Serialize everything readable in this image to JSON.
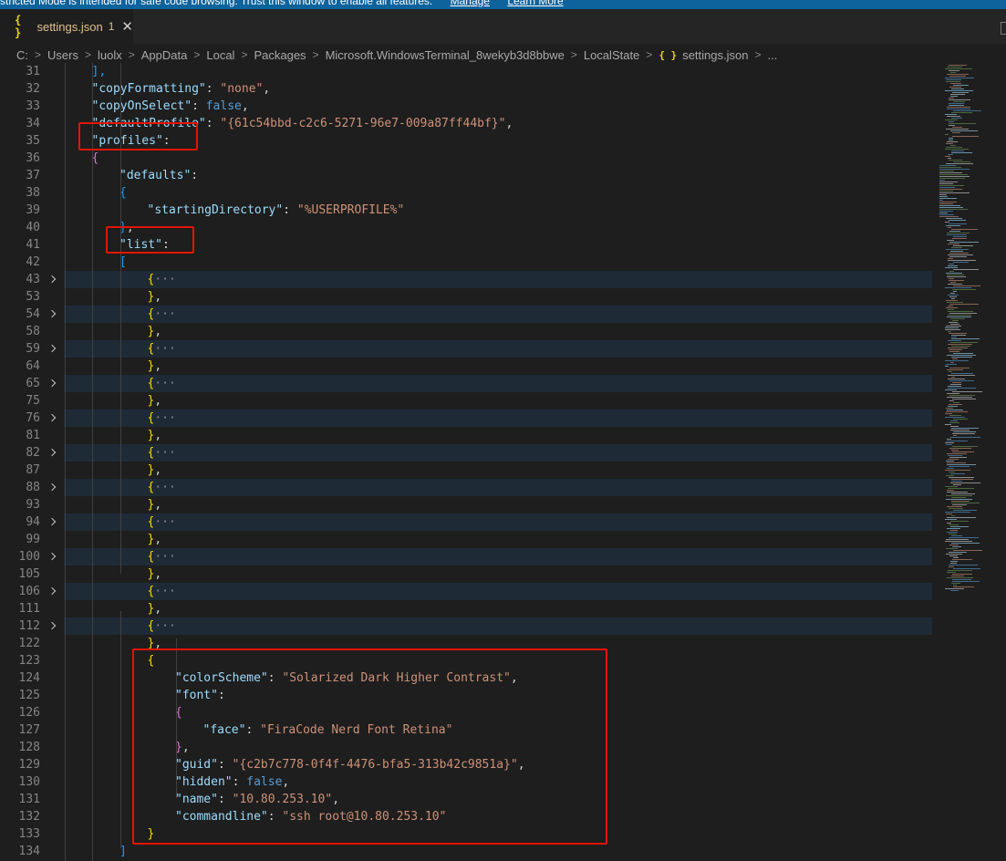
{
  "banner": {
    "text": "stricted Mode is intended for safe code browsing. Trust this window to enable all features.",
    "manage": "Manage",
    "learn_more": "Learn More"
  },
  "tab": {
    "icon_text": "{ }",
    "title": "settings.json",
    "badge": "1",
    "close": "✕"
  },
  "breadcrumb": {
    "segments": [
      "C:",
      "Users",
      "luolx",
      "AppData",
      "Local",
      "Packages",
      "Microsoft.WindowsTerminal_8wekyb3d8bbwe",
      "LocalState"
    ],
    "file_icon": "{ }",
    "file": "settings.json",
    "ellipsis": "..."
  },
  "colors": {
    "string": "#ce9178",
    "key": "#9cdcfe",
    "keyword": "#569cd6",
    "highlight_box": "#e51400",
    "folded_line_bg": "#1f2a37"
  },
  "icons": {
    "fold_chevron": "chevron-right-icon",
    "json_file": "json-braces-icon",
    "close": "close-icon"
  },
  "editor": {
    "lines": [
      {
        "n": "31",
        "i": 1,
        "fold": false,
        "t": [
          {
            "c": "b3",
            "v": "],"
          }
        ]
      },
      {
        "n": "32",
        "i": 1,
        "fold": false,
        "t": [
          {
            "c": "k",
            "v": "\"copyFormatting\""
          },
          {
            "c": "p",
            "v": ": "
          },
          {
            "c": "s",
            "v": "\"none\""
          },
          {
            "c": "p",
            "v": ","
          }
        ]
      },
      {
        "n": "33",
        "i": 1,
        "fold": false,
        "t": [
          {
            "c": "k",
            "v": "\"copyOnSelect\""
          },
          {
            "c": "p",
            "v": ": "
          },
          {
            "c": "kw",
            "v": "false"
          },
          {
            "c": "p",
            "v": ","
          }
        ]
      },
      {
        "n": "34",
        "i": 1,
        "fold": false,
        "t": [
          {
            "c": "k",
            "v": "\"defaultProfile\""
          },
          {
            "c": "p",
            "v": ": "
          },
          {
            "c": "s",
            "v": "\"{61c54bbd-c2c6-5271-96e7-009a87ff44bf}\""
          },
          {
            "c": "p",
            "v": ","
          }
        ]
      },
      {
        "n": "35",
        "i": 1,
        "fold": false,
        "t": [
          {
            "c": "k",
            "v": "\"profiles\""
          },
          {
            "c": "p",
            "v": ":"
          }
        ]
      },
      {
        "n": "36",
        "i": 1,
        "fold": false,
        "t": [
          {
            "c": "b2",
            "v": "{"
          }
        ]
      },
      {
        "n": "37",
        "i": 2,
        "fold": false,
        "t": [
          {
            "c": "k",
            "v": "\"defaults\""
          },
          {
            "c": "p",
            "v": ":"
          }
        ]
      },
      {
        "n": "38",
        "i": 2,
        "fold": false,
        "t": [
          {
            "c": "b3",
            "v": "{"
          }
        ]
      },
      {
        "n": "39",
        "i": 3,
        "fold": false,
        "t": [
          {
            "c": "k",
            "v": "\"startingDirectory\""
          },
          {
            "c": "p",
            "v": ": "
          },
          {
            "c": "s",
            "v": "\"%USERPROFILE%\""
          }
        ]
      },
      {
        "n": "40",
        "i": 2,
        "fold": false,
        "t": [
          {
            "c": "b3",
            "v": "}"
          },
          {
            "c": "p",
            "v": ","
          }
        ]
      },
      {
        "n": "41",
        "i": 2,
        "fold": false,
        "t": [
          {
            "c": "k",
            "v": "\"list\""
          },
          {
            "c": "p",
            "v": ":"
          }
        ]
      },
      {
        "n": "42",
        "i": 2,
        "fold": false,
        "t": [
          {
            "c": "b3",
            "v": "["
          }
        ]
      },
      {
        "n": "43",
        "i": 3,
        "fold": true,
        "t": [
          {
            "c": "b1",
            "v": "{"
          },
          {
            "c": "dots",
            "v": "···"
          }
        ]
      },
      {
        "n": "53",
        "i": 3,
        "fold": false,
        "t": [
          {
            "c": "b1",
            "v": "}"
          },
          {
            "c": "p",
            "v": ","
          }
        ]
      },
      {
        "n": "54",
        "i": 3,
        "fold": true,
        "t": [
          {
            "c": "b1",
            "v": "{"
          },
          {
            "c": "dots",
            "v": "···"
          }
        ]
      },
      {
        "n": "58",
        "i": 3,
        "fold": false,
        "t": [
          {
            "c": "b1",
            "v": "}"
          },
          {
            "c": "p",
            "v": ","
          }
        ]
      },
      {
        "n": "59",
        "i": 3,
        "fold": true,
        "t": [
          {
            "c": "b1",
            "v": "{"
          },
          {
            "c": "dots",
            "v": "···"
          }
        ]
      },
      {
        "n": "64",
        "i": 3,
        "fold": false,
        "t": [
          {
            "c": "b1",
            "v": "}"
          },
          {
            "c": "p",
            "v": ","
          }
        ]
      },
      {
        "n": "65",
        "i": 3,
        "fold": true,
        "t": [
          {
            "c": "b1",
            "v": "{"
          },
          {
            "c": "dots",
            "v": "···"
          }
        ]
      },
      {
        "n": "75",
        "i": 3,
        "fold": false,
        "t": [
          {
            "c": "b1",
            "v": "}"
          },
          {
            "c": "p",
            "v": ","
          }
        ]
      },
      {
        "n": "76",
        "i": 3,
        "fold": true,
        "t": [
          {
            "c": "b1",
            "v": "{"
          },
          {
            "c": "dots",
            "v": "···"
          }
        ]
      },
      {
        "n": "81",
        "i": 3,
        "fold": false,
        "t": [
          {
            "c": "b1",
            "v": "}"
          },
          {
            "c": "p",
            "v": ","
          }
        ]
      },
      {
        "n": "82",
        "i": 3,
        "fold": true,
        "t": [
          {
            "c": "b1",
            "v": "{"
          },
          {
            "c": "dots",
            "v": "···"
          }
        ]
      },
      {
        "n": "87",
        "i": 3,
        "fold": false,
        "t": [
          {
            "c": "b1",
            "v": "}"
          },
          {
            "c": "p",
            "v": ","
          }
        ]
      },
      {
        "n": "88",
        "i": 3,
        "fold": true,
        "t": [
          {
            "c": "b1",
            "v": "{"
          },
          {
            "c": "dots",
            "v": "···"
          }
        ]
      },
      {
        "n": "93",
        "i": 3,
        "fold": false,
        "t": [
          {
            "c": "b1",
            "v": "}"
          },
          {
            "c": "p",
            "v": ","
          }
        ]
      },
      {
        "n": "94",
        "i": 3,
        "fold": true,
        "t": [
          {
            "c": "b1",
            "v": "{"
          },
          {
            "c": "dots",
            "v": "···"
          }
        ]
      },
      {
        "n": "99",
        "i": 3,
        "fold": false,
        "t": [
          {
            "c": "b1",
            "v": "}"
          },
          {
            "c": "p",
            "v": ","
          }
        ]
      },
      {
        "n": "100",
        "i": 3,
        "fold": true,
        "t": [
          {
            "c": "b1",
            "v": "{"
          },
          {
            "c": "dots",
            "v": "···"
          }
        ]
      },
      {
        "n": "105",
        "i": 3,
        "fold": false,
        "t": [
          {
            "c": "b1",
            "v": "}"
          },
          {
            "c": "p",
            "v": ","
          }
        ]
      },
      {
        "n": "106",
        "i": 3,
        "fold": true,
        "t": [
          {
            "c": "b1",
            "v": "{"
          },
          {
            "c": "dots",
            "v": "···"
          }
        ]
      },
      {
        "n": "111",
        "i": 3,
        "fold": false,
        "t": [
          {
            "c": "b1",
            "v": "}"
          },
          {
            "c": "p",
            "v": ","
          }
        ]
      },
      {
        "n": "112",
        "i": 3,
        "fold": true,
        "t": [
          {
            "c": "b1",
            "v": "{"
          },
          {
            "c": "dots",
            "v": "···"
          }
        ]
      },
      {
        "n": "122",
        "i": 3,
        "fold": false,
        "t": [
          {
            "c": "b1",
            "v": "}"
          },
          {
            "c": "p",
            "v": ","
          }
        ]
      },
      {
        "n": "123",
        "i": 3,
        "fold": false,
        "t": [
          {
            "c": "b1",
            "v": "{"
          }
        ]
      },
      {
        "n": "124",
        "i": 4,
        "fold": false,
        "t": [
          {
            "c": "k",
            "v": "\"colorScheme\""
          },
          {
            "c": "p",
            "v": ": "
          },
          {
            "c": "s",
            "v": "\"Solarized Dark Higher Contrast\""
          },
          {
            "c": "p",
            "v": ","
          }
        ]
      },
      {
        "n": "125",
        "i": 4,
        "fold": false,
        "t": [
          {
            "c": "k",
            "v": "\"font\""
          },
          {
            "c": "p",
            "v": ":"
          }
        ]
      },
      {
        "n": "126",
        "i": 4,
        "fold": false,
        "t": [
          {
            "c": "b2",
            "v": "{"
          }
        ]
      },
      {
        "n": "127",
        "i": 5,
        "fold": false,
        "t": [
          {
            "c": "k",
            "v": "\"face\""
          },
          {
            "c": "p",
            "v": ": "
          },
          {
            "c": "s",
            "v": "\"FiraCode Nerd Font Retina\""
          }
        ]
      },
      {
        "n": "128",
        "i": 4,
        "fold": false,
        "t": [
          {
            "c": "b2",
            "v": "}"
          },
          {
            "c": "p",
            "v": ","
          }
        ]
      },
      {
        "n": "129",
        "i": 4,
        "fold": false,
        "t": [
          {
            "c": "k",
            "v": "\"guid\""
          },
          {
            "c": "p",
            "v": ": "
          },
          {
            "c": "s",
            "v": "\"{c2b7c778-0f4f-4476-bfa5-313b42c9851a}\""
          },
          {
            "c": "p",
            "v": ","
          }
        ]
      },
      {
        "n": "130",
        "i": 4,
        "fold": false,
        "t": [
          {
            "c": "k",
            "v": "\"hidden\""
          },
          {
            "c": "p",
            "v": ": "
          },
          {
            "c": "kw",
            "v": "false"
          },
          {
            "c": "p",
            "v": ","
          }
        ]
      },
      {
        "n": "131",
        "i": 4,
        "fold": false,
        "t": [
          {
            "c": "k",
            "v": "\"name\""
          },
          {
            "c": "p",
            "v": ": "
          },
          {
            "c": "s",
            "v": "\"10.80.253.10\""
          },
          {
            "c": "p",
            "v": ","
          }
        ]
      },
      {
        "n": "132",
        "i": 4,
        "fold": false,
        "t": [
          {
            "c": "k",
            "v": "\"commandline\""
          },
          {
            "c": "p",
            "v": ": "
          },
          {
            "c": "s",
            "v": "\"ssh root@10.80.253.10\""
          }
        ]
      },
      {
        "n": "133",
        "i": 3,
        "fold": false,
        "t": [
          {
            "c": "b1",
            "v": "}"
          }
        ]
      },
      {
        "n": "134",
        "i": 2,
        "fold": false,
        "t": [
          {
            "c": "b3",
            "v": "]"
          }
        ]
      }
    ]
  }
}
